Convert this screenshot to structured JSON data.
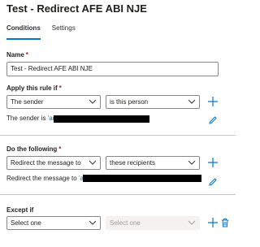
{
  "page": {
    "title": "Test - Redirect AFE ABI NJE"
  },
  "tabs": [
    {
      "label": "Conditions",
      "active": true
    },
    {
      "label": "Settings",
      "active": false
    }
  ],
  "name_field": {
    "label": "Name",
    "required_mark": "*",
    "value": "Test - Redirect AFE ABI NJE"
  },
  "apply_rule": {
    "label": "Apply this rule if",
    "required_mark": "*",
    "condition_select": "The sender",
    "operator_select": "is this person",
    "summary_prefix": "The sender is",
    "summary_value": "'ar"
  },
  "do_following": {
    "label": "Do the following",
    "required_mark": "*",
    "action_select": "Redirect the message to",
    "target_select": "these recipients",
    "summary_prefix": "Redirect the message to",
    "summary_value": "'ab"
  },
  "except_if": {
    "label": "Except if",
    "condition_select": "Select one",
    "operator_select": "Select one"
  },
  "icons": {
    "add": "plus-icon",
    "edit": "pencil-icon",
    "delete": "trash-icon",
    "dropdown": "chevron-down-icon"
  },
  "colors": {
    "accent": "#0078d4",
    "required": "#a4262c",
    "border": "#8a8886",
    "disabled": "#f3f2f1"
  }
}
